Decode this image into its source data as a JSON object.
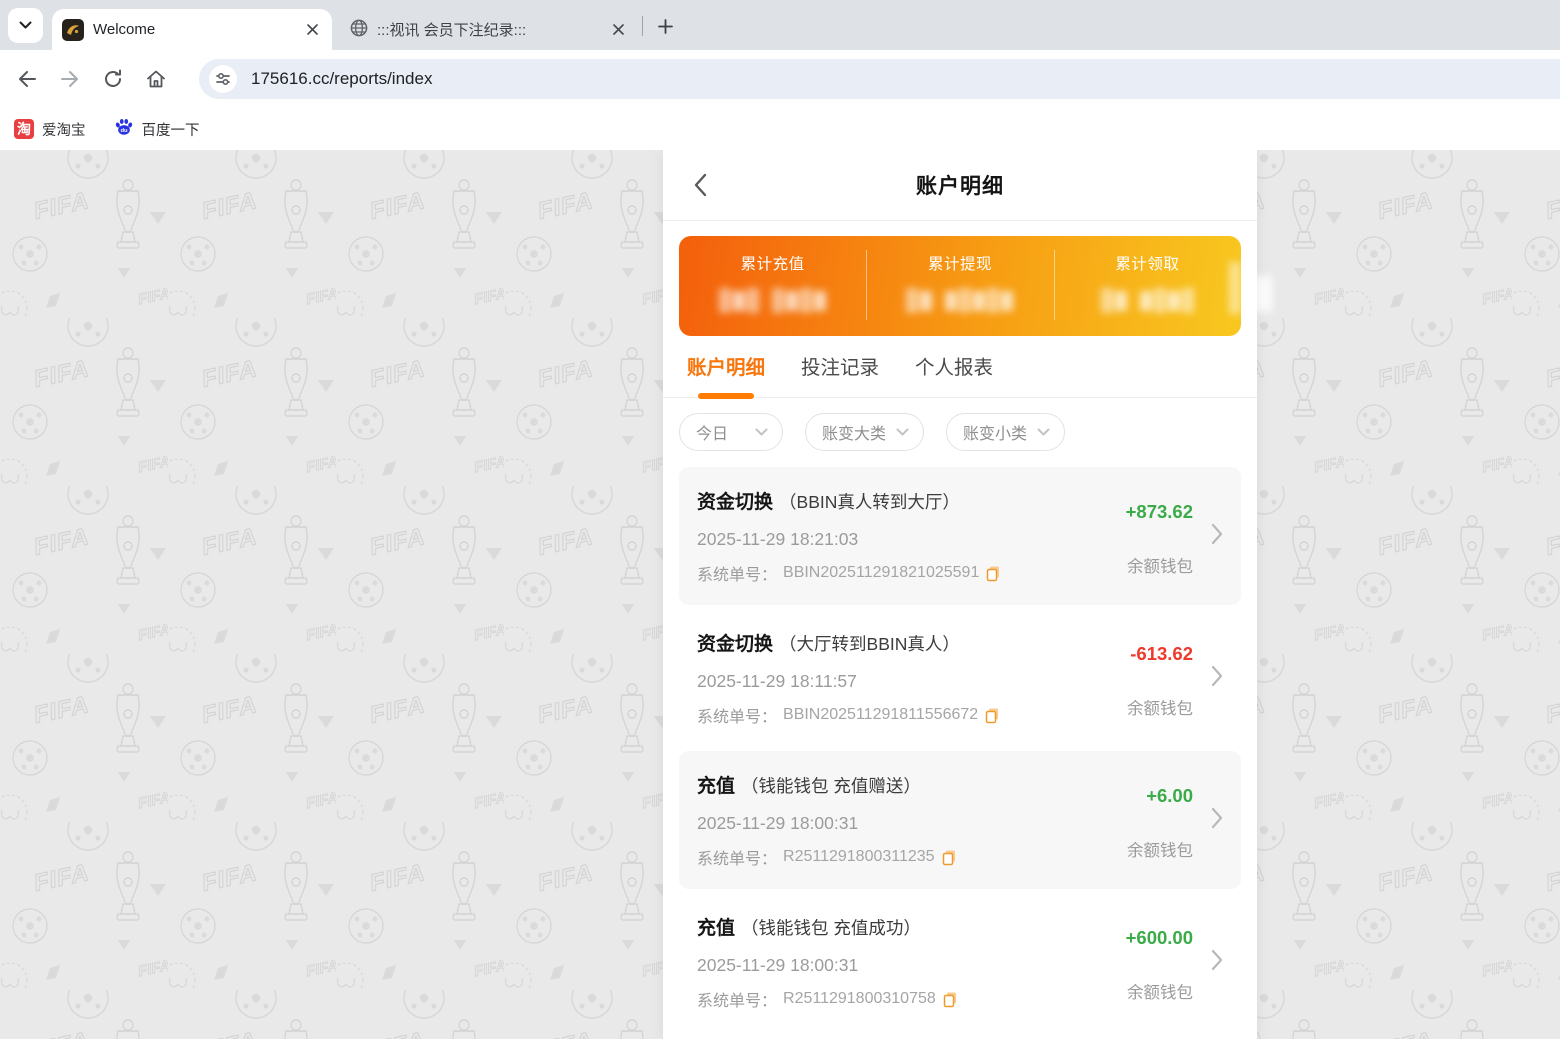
{
  "browser": {
    "tabs": [
      {
        "title": "Welcome",
        "active": true
      },
      {
        "title": ":::视讯 会员下注纪录:::",
        "active": false
      }
    ],
    "url": "175616.cc/reports/index",
    "bookmarks": [
      {
        "label": "爱淘宝",
        "icon": "taobao-icon",
        "icon_char": "淘",
        "icon_color": "#e83f40"
      },
      {
        "label": "百度一下",
        "icon": "baidu-paw-icon",
        "icon_color": "#2932e1"
      }
    ]
  },
  "page": {
    "header": {
      "title": "账户明细"
    },
    "stats": [
      {
        "label": "累计充值",
        "value_censored": true,
        "censored_groups": [
          3,
          4
        ]
      },
      {
        "label": "累计提现",
        "value_censored": true,
        "censored_groups": [
          2,
          5
        ]
      },
      {
        "label": "累计领取",
        "value_censored": true,
        "censored_groups": [
          2,
          4
        ]
      }
    ],
    "tabs": [
      {
        "label": "账户明细",
        "active": true
      },
      {
        "label": "投注记录",
        "active": false
      },
      {
        "label": "个人报表",
        "active": false
      }
    ],
    "filters": [
      {
        "label": "今日"
      },
      {
        "label": "账变大类"
      },
      {
        "label": "账变小类"
      }
    ],
    "order_label": "系统单号：",
    "transactions": [
      {
        "type": "资金切换",
        "detail": "（BBIN真人转到大厅）",
        "time": "2025-11-29 18:21:03",
        "order": "BBIN202511291821025591",
        "amount": "+873.62",
        "wallet": "余额钱包"
      },
      {
        "type": "资金切换",
        "detail": "（大厅转到BBIN真人）",
        "time": "2025-11-29 18:11:57",
        "order": "BBIN202511291811556672",
        "amount": "-613.62",
        "wallet": "余额钱包"
      },
      {
        "type": "充值",
        "detail": "（钱能钱包 充值赠送）",
        "time": "2025-11-29 18:00:31",
        "order": "R2511291800311235",
        "amount": "+6.00",
        "wallet": "余额钱包"
      },
      {
        "type": "充值",
        "detail": "（钱能钱包 充值成功）",
        "time": "2025-11-29 18:00:31",
        "order": "R2511291800310758",
        "amount": "+600.00",
        "wallet": "余额钱包"
      }
    ]
  },
  "colors": {
    "accent_orange": "#f7770e",
    "card_gradient_start": "#f45f0c",
    "card_gradient_end": "#f8c81f",
    "amount_positive": "#3aab47",
    "amount_negative": "#ee392b",
    "copy_icon": "#f09a2c"
  }
}
